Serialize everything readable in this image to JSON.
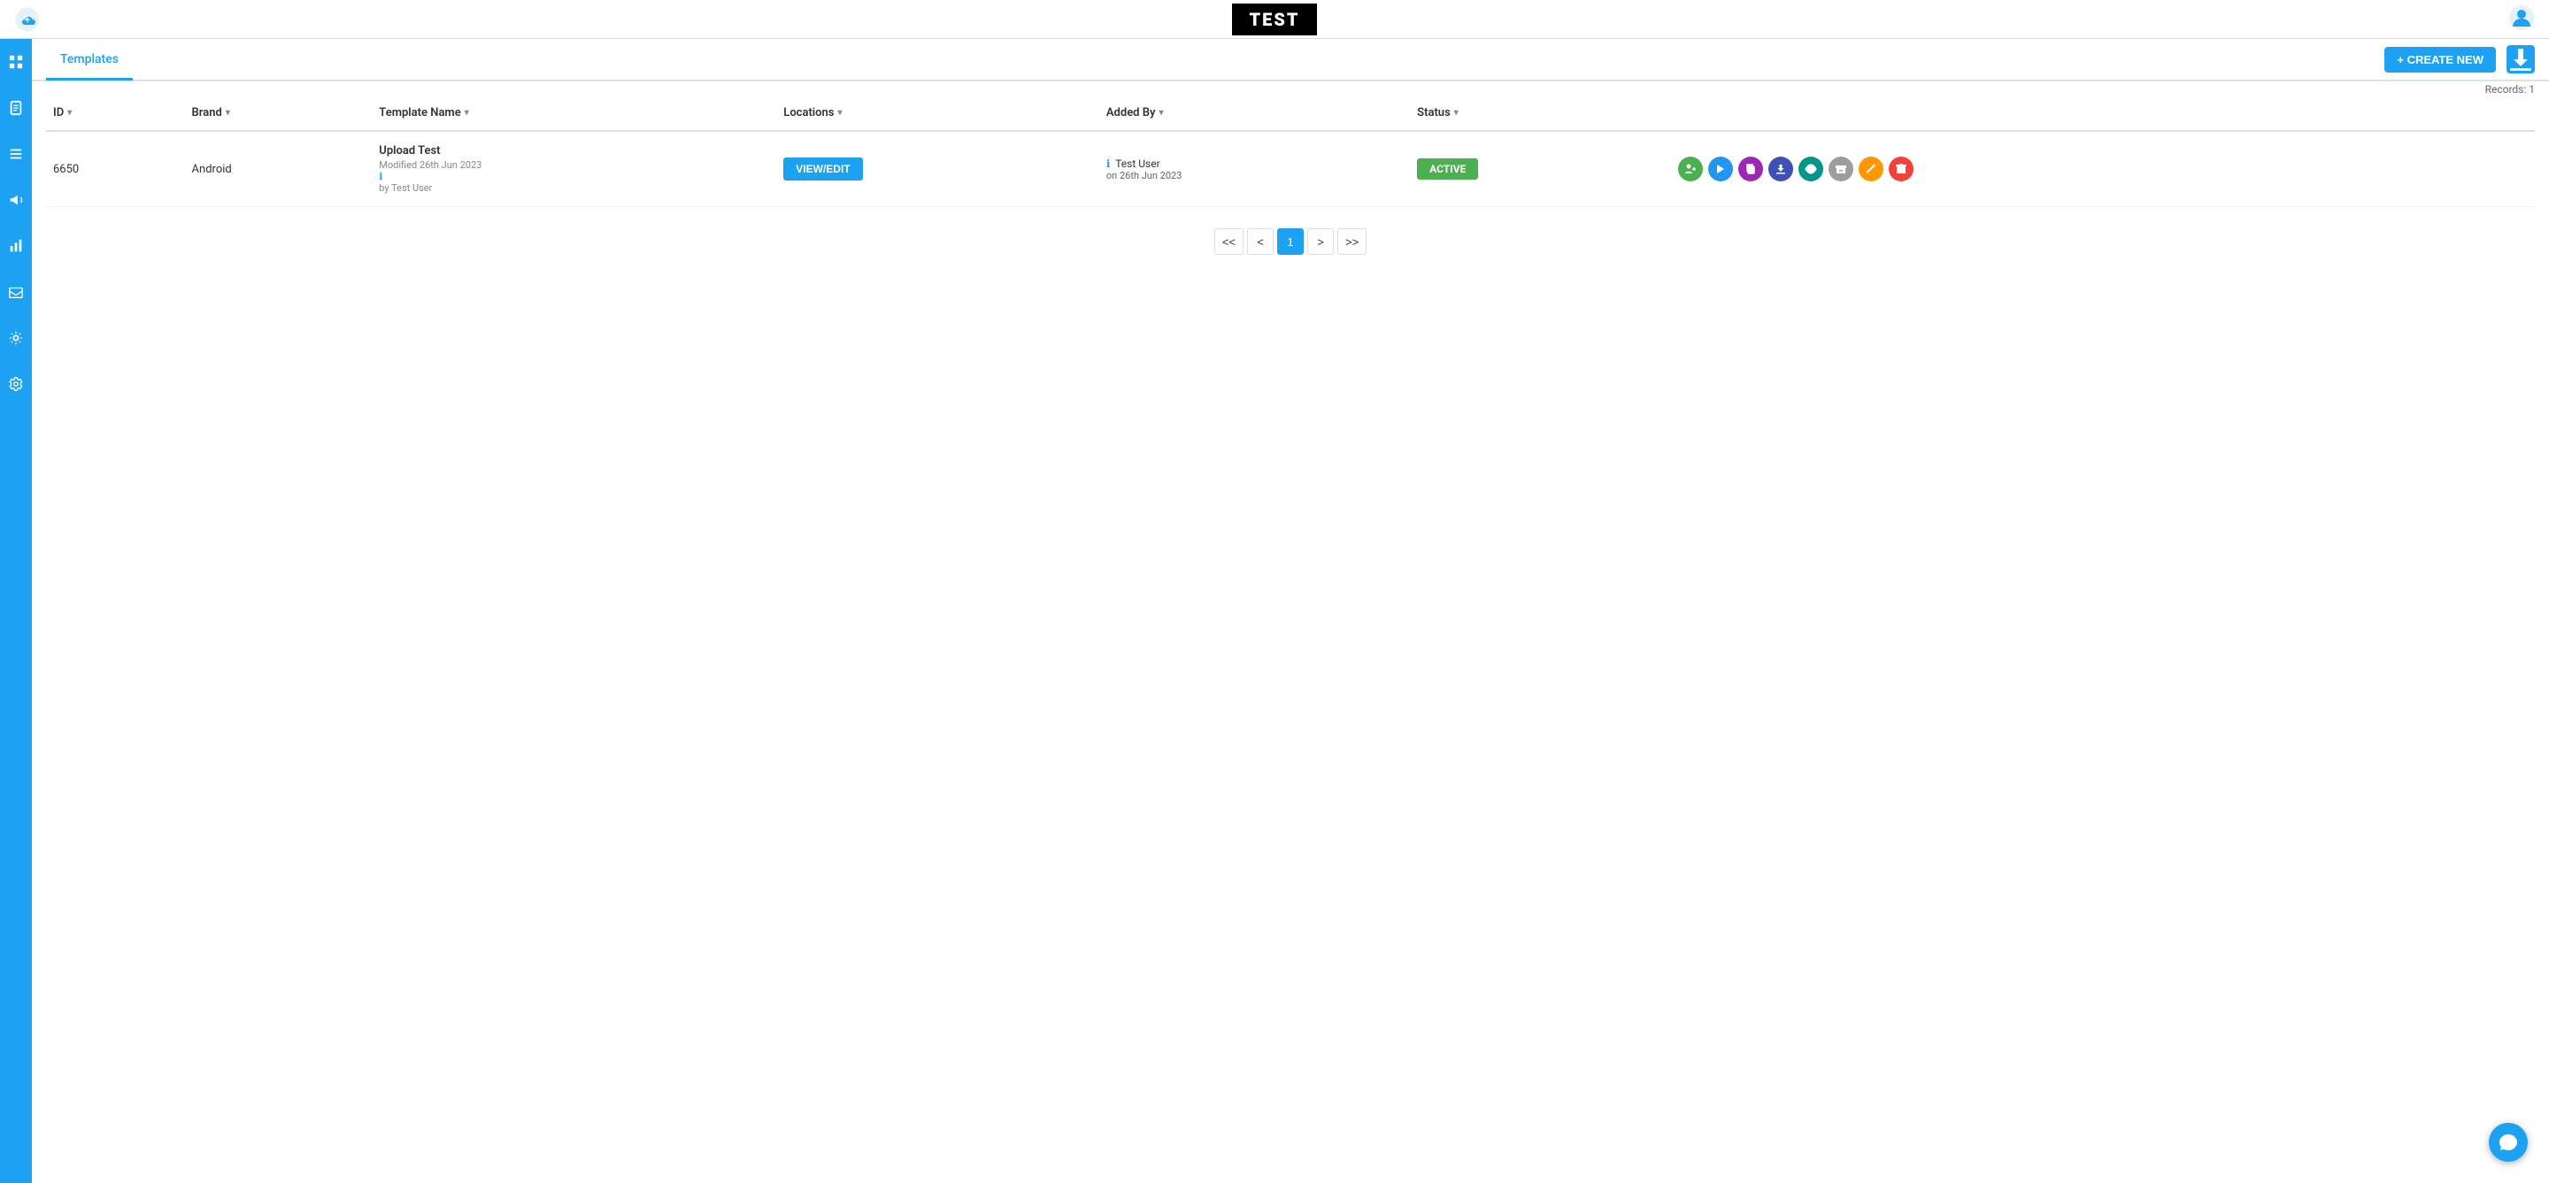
{
  "topBar": {
    "title": "TEST",
    "logoAlt": "cloud-logo"
  },
  "tabs": {
    "activeTab": "Templates",
    "items": [
      {
        "label": "Templates",
        "active": true
      }
    ]
  },
  "toolbar": {
    "createNewLabel": "+ CREATE NEW",
    "recordsInfo": "Records: 1"
  },
  "table": {
    "columns": [
      {
        "key": "id",
        "label": "ID"
      },
      {
        "key": "brand",
        "label": "Brand"
      },
      {
        "key": "templateName",
        "label": "Template Name"
      },
      {
        "key": "locations",
        "label": "Locations"
      },
      {
        "key": "addedBy",
        "label": "Added By"
      },
      {
        "key": "status",
        "label": "Status"
      }
    ],
    "rows": [
      {
        "id": "6650",
        "brand": "Android",
        "templateName": "Upload Test",
        "templateModified": "Modified 26th Jun 2023",
        "templateBy": "by Test User",
        "locationsBtnLabel": "VIEW/EDIT",
        "addedByUser": "Test User",
        "addedByDate": "on 26th Jun 2023",
        "status": "ACTIVE"
      }
    ]
  },
  "pagination": {
    "first": "<<",
    "prev": "<",
    "current": "1",
    "next": ">",
    "last": ">>"
  },
  "sidebar": {
    "items": [
      {
        "name": "grid-icon",
        "symbol": "⊞"
      },
      {
        "name": "document-icon",
        "symbol": "📄"
      },
      {
        "name": "list-icon",
        "symbol": "☰"
      },
      {
        "name": "megaphone-icon",
        "symbol": "📣"
      },
      {
        "name": "chart-icon",
        "symbol": "📊"
      },
      {
        "name": "inbox-icon",
        "symbol": "📥"
      },
      {
        "name": "settings-alt-icon",
        "symbol": "⚙"
      },
      {
        "name": "gear-icon",
        "symbol": "🔧"
      }
    ]
  },
  "actionButtons": {
    "colors": {
      "assign": "#4caf50",
      "play": "#2196f3",
      "purple": "#9c27b0",
      "download": "#3f51b5",
      "eye": "#009688",
      "gray": "#9e9e9e",
      "edit": "#ff9800",
      "delete": "#f44336"
    }
  }
}
